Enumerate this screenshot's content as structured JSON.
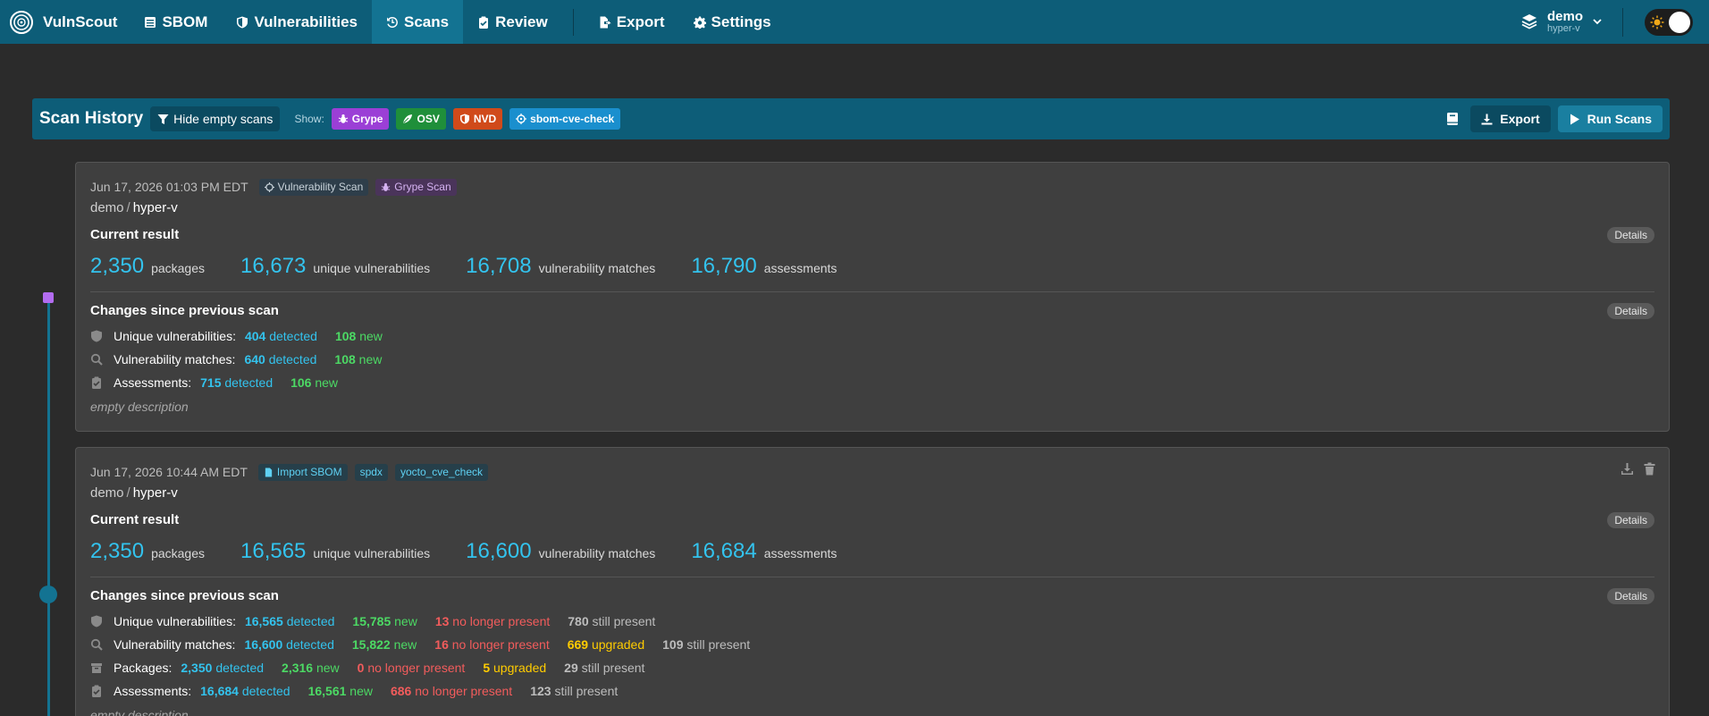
{
  "nav": {
    "brand": "VulnScout",
    "items": [
      {
        "label": "SBOM",
        "icon": "sbom-icon"
      },
      {
        "label": "Vulnerabilities",
        "icon": "shield-icon"
      },
      {
        "label": "Scans",
        "icon": "history-icon",
        "active": true
      },
      {
        "label": "Review",
        "icon": "clipboard-check-icon"
      }
    ],
    "export_label": "Export",
    "settings_label": "Settings",
    "project": {
      "name": "demo",
      "variant": "hyper-v"
    }
  },
  "history_bar": {
    "title": "Scan History",
    "hide_empty_label": "Hide empty scans",
    "show_label": "Show:",
    "sources": [
      {
        "label": "Grype",
        "color": "#9b3fd6"
      },
      {
        "label": "OSV",
        "color": "#1f8f3a"
      },
      {
        "label": "NVD",
        "color": "#d04a1a"
      },
      {
        "label": "sbom-cve-check",
        "color": "#1a8fce"
      }
    ],
    "export_label": "Export",
    "run_label": "Run Scans"
  },
  "scans": [
    {
      "date": "Jun 17, 2026 01:03 PM EDT",
      "tags": [
        "Vulnerability Scan",
        "Grype Scan"
      ],
      "project": "demo",
      "variant": "hyper-v",
      "current_result_label": "Current result",
      "details_label": "Details",
      "stats": [
        {
          "value": "2,350",
          "label": "packages"
        },
        {
          "value": "16,673",
          "label": "unique vulnerabilities"
        },
        {
          "value": "16,708",
          "label": "vulnerability matches"
        },
        {
          "value": "16,790",
          "label": "assessments"
        }
      ],
      "changes_label": "Changes since previous scan",
      "changes": [
        {
          "label": "Unique vulnerabilities:",
          "detected": "404",
          "new": "108"
        },
        {
          "label": "Vulnerability matches:",
          "detected": "640",
          "new": "108"
        },
        {
          "label": "Assessments:",
          "detected": "715",
          "new": "106"
        }
      ],
      "description": "empty description"
    },
    {
      "date": "Jun 17, 2026 10:44 AM EDT",
      "tags": [
        "Import SBOM",
        "spdx",
        "yocto_cve_check"
      ],
      "project": "demo",
      "variant": "hyper-v",
      "current_result_label": "Current result",
      "details_label": "Details",
      "stats": [
        {
          "value": "2,350",
          "label": "packages"
        },
        {
          "value": "16,565",
          "label": "unique vulnerabilities"
        },
        {
          "value": "16,600",
          "label": "vulnerability matches"
        },
        {
          "value": "16,684",
          "label": "assessments"
        }
      ],
      "changes_label": "Changes since previous scan",
      "changes": [
        {
          "label": "Unique vulnerabilities:",
          "detected": "16,565",
          "new": "15,785",
          "gone": "13",
          "still": "780"
        },
        {
          "label": "Vulnerability matches:",
          "detected": "16,600",
          "new": "15,822",
          "gone": "16",
          "upgraded": "669",
          "still": "109"
        },
        {
          "label": "Packages:",
          "detected": "2,350",
          "new": "2,316",
          "gone": "0",
          "upgraded": "5",
          "still": "29"
        },
        {
          "label": "Assessments:",
          "detected": "16,684",
          "new": "16,561",
          "gone": "686",
          "still": "123"
        }
      ],
      "description": "empty description"
    }
  ],
  "words": {
    "detected": "detected",
    "new": "new",
    "no_longer_present": "no longer present",
    "upgraded": "upgraded",
    "still_present": "still present",
    "slash": "/"
  }
}
